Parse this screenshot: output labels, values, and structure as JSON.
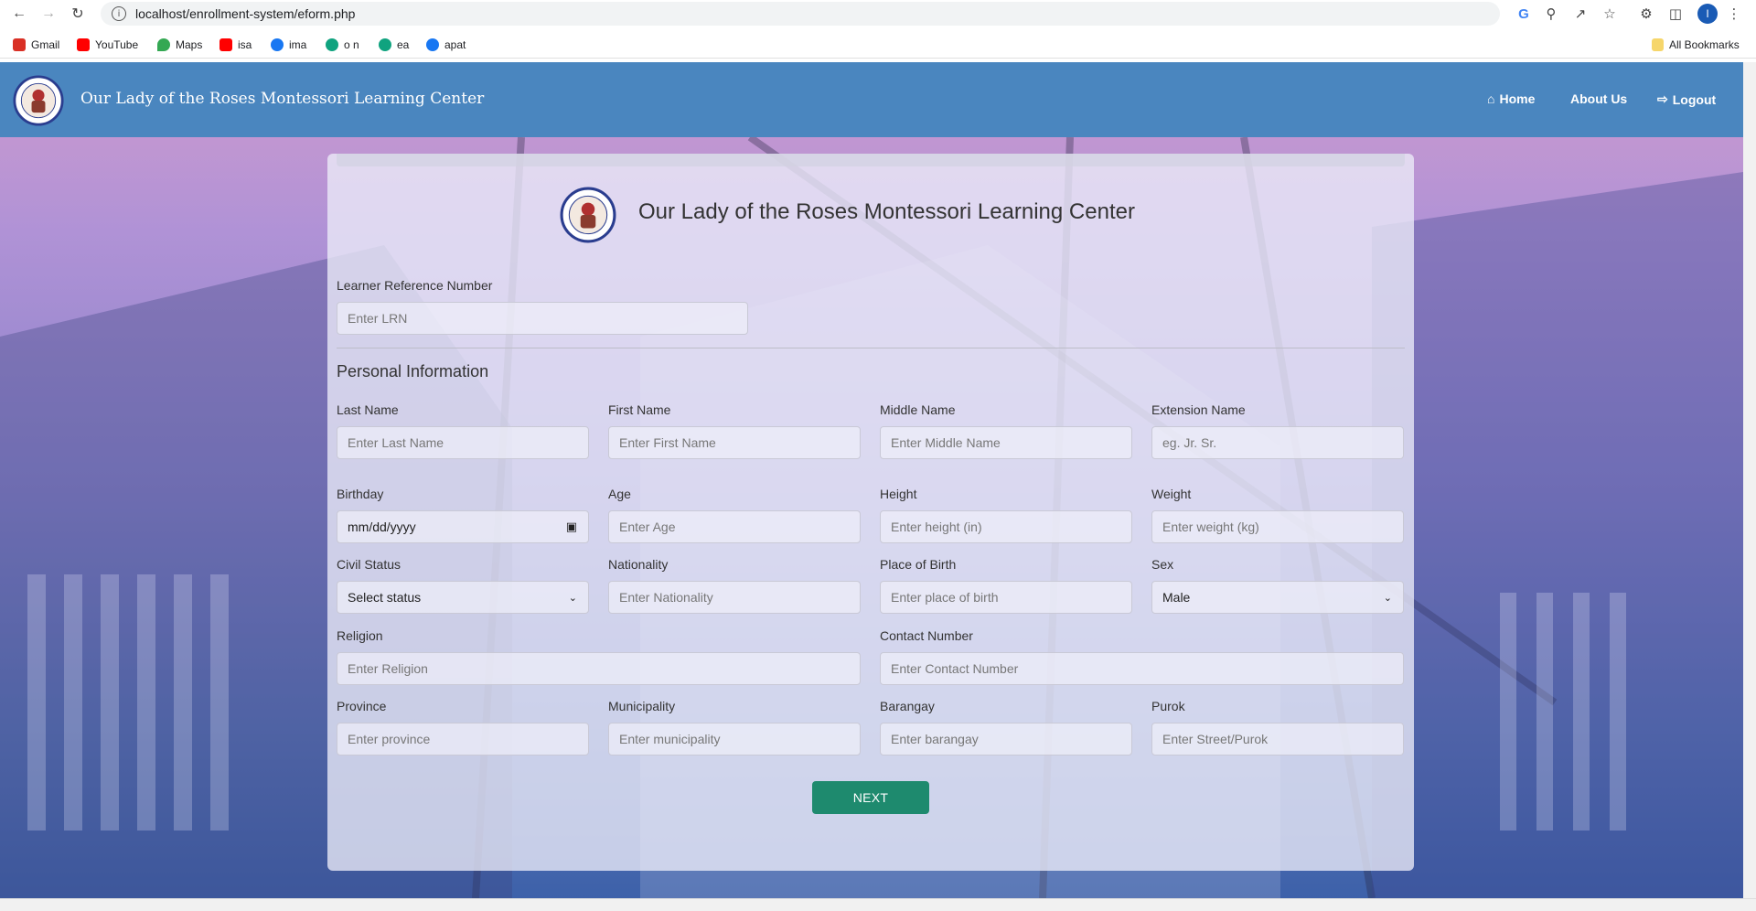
{
  "browser": {
    "url": "localhost/enrollment-system/eform.php",
    "profile_initial": "I",
    "bookmarks": [
      {
        "label": "Gmail",
        "color": "#d93025"
      },
      {
        "label": "YouTube",
        "color": "#ff0000"
      },
      {
        "label": "Maps",
        "color": "#34a853"
      },
      {
        "label": "isa",
        "color": "#ff0000"
      },
      {
        "label": "ima",
        "color": "#1877f2"
      },
      {
        "label": "o n",
        "color": "#10a37f"
      },
      {
        "label": "ea",
        "color": "#10a37f"
      },
      {
        "label": "apat",
        "color": "#1877f2"
      }
    ],
    "all_bookmarks": "All Bookmarks"
  },
  "navbar": {
    "brand": "Our Lady of the Roses Montessori Learning Center",
    "links": {
      "home": "Home",
      "about": "About Us",
      "logout": "Logout"
    },
    "color": "#4a86bf"
  },
  "form": {
    "title": "Our Lady of the Roses Montessori Learning Center",
    "lrn": {
      "label": "Learner Reference Number",
      "placeholder": "Enter LRN"
    },
    "section_title": "Personal Information",
    "fields": {
      "last_name": {
        "label": "Last Name",
        "placeholder": "Enter Last Name"
      },
      "first_name": {
        "label": "First Name",
        "placeholder": "Enter First Name"
      },
      "middle_name": {
        "label": "Middle Name",
        "placeholder": "Enter Middle Name"
      },
      "extension_name": {
        "label": "Extension Name",
        "placeholder": "eg. Jr. Sr."
      },
      "birthday": {
        "label": "Birthday",
        "value": "mm/dd/yyyy"
      },
      "age": {
        "label": "Age",
        "placeholder": "Enter Age"
      },
      "height": {
        "label": "Height",
        "placeholder": "Enter height (in)"
      },
      "weight": {
        "label": "Weight",
        "placeholder": "Enter weight (kg)"
      },
      "civil_status": {
        "label": "Civil Status",
        "value": "Select status"
      },
      "nationality": {
        "label": "Nationality",
        "placeholder": "Enter Nationality"
      },
      "place_of_birth": {
        "label": "Place of Birth",
        "placeholder": "Enter place of birth"
      },
      "sex": {
        "label": "Sex",
        "value": "Male"
      },
      "religion": {
        "label": "Religion",
        "placeholder": "Enter Religion"
      },
      "contact_number": {
        "label": "Contact Number",
        "placeholder": "Enter Contact Number"
      },
      "province": {
        "label": "Province",
        "placeholder": "Enter province"
      },
      "municipality": {
        "label": "Municipality",
        "placeholder": "Enter municipality"
      },
      "barangay": {
        "label": "Barangay",
        "placeholder": "Enter barangay"
      },
      "purok": {
        "label": "Purok",
        "placeholder": "Enter Street/Purok"
      }
    },
    "next_label": "NEXT",
    "accent": "#1e8a6e"
  }
}
